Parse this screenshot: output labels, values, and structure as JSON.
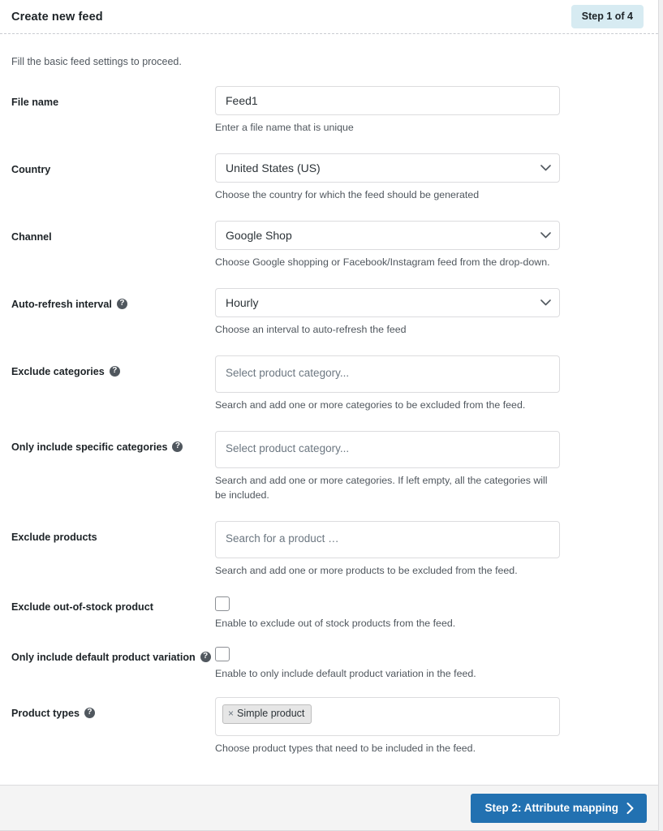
{
  "header": {
    "title": "Create new feed",
    "step_badge": "Step 1 of 4"
  },
  "intro": "Fill the basic feed settings to proceed.",
  "fields": [
    {
      "label": "File name",
      "help": false,
      "type": "text",
      "value": "Feed1",
      "placeholder": "",
      "helper": "Enter a file name that is unique"
    },
    {
      "label": "Country",
      "help": false,
      "type": "select",
      "value": "United States (US)",
      "helper": "Choose the country for which the feed should be generated"
    },
    {
      "label": "Channel",
      "help": false,
      "type": "select",
      "value": "Google Shop",
      "helper": "Choose Google shopping or Facebook/Instagram feed from the drop-down."
    },
    {
      "label": "Auto-refresh interval",
      "help": true,
      "type": "select",
      "value": "Hourly",
      "helper": "Choose an interval to auto-refresh the feed"
    },
    {
      "label": "Exclude categories",
      "help": true,
      "type": "multiselect",
      "placeholder": "Select product category...",
      "helper": "Search and add one or more categories to be excluded from the feed."
    },
    {
      "label": "Only include specific categories",
      "help": true,
      "type": "multiselect",
      "placeholder": "Select product category...",
      "helper": "Search and add one or more categories. If left empty, all the categories will be included."
    },
    {
      "label": "Exclude products",
      "help": false,
      "type": "multiselect",
      "placeholder": "Search for a product …",
      "helper": "Search and add one or more products to be excluded from the feed."
    },
    {
      "label": "Exclude out-of-stock product",
      "help": false,
      "type": "checkbox",
      "checked": false,
      "helper": "Enable to exclude out of stock products from the feed."
    },
    {
      "label": "Only include default product variation",
      "help": true,
      "type": "checkbox",
      "checked": false,
      "helper": "Enable to only include default product variation in the feed."
    },
    {
      "label": "Product types",
      "help": true,
      "type": "chips",
      "chips": [
        "Simple product"
      ],
      "chip_remove": "×",
      "helper": "Choose product types that need to be included in the feed."
    }
  ],
  "footer": {
    "next_label": "Step 2: Attribute mapping"
  },
  "icons": {
    "help": "?",
    "caret_down": "chevron-down-icon",
    "next_chevron": "chevron-right-icon"
  },
  "colors": {
    "accent": "#2271b1",
    "badge_bg": "#d7ebf2",
    "border": "#dcdcde",
    "text": "#1d2327",
    "muted": "#50575e"
  }
}
